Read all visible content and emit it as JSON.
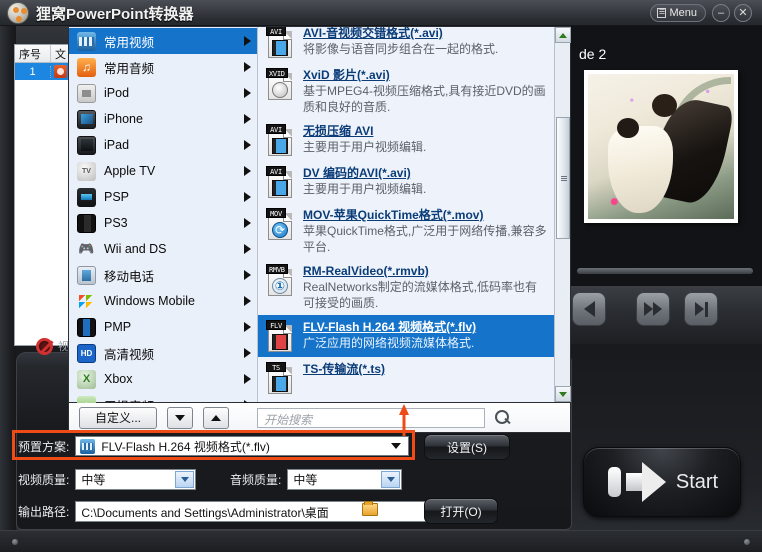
{
  "window": {
    "title": "狸窝PowerPoint转换器",
    "menu_label": "Menu",
    "minimize_label": "–",
    "close_label": "✕"
  },
  "filelist": {
    "columns": [
      "序号",
      "文"
    ],
    "rows": [
      {
        "num": "1"
      }
    ],
    "footer_text": "视"
  },
  "categories": [
    {
      "label": "常用视频",
      "icon": "video-icon",
      "selected": true
    },
    {
      "label": "常用音频",
      "icon": "audio-icon",
      "selected": false
    },
    {
      "label": "iPod",
      "icon": "ipod-icon",
      "selected": false
    },
    {
      "label": "iPhone",
      "icon": "iphone-icon",
      "selected": false
    },
    {
      "label": "iPad",
      "icon": "ipad-icon",
      "selected": false
    },
    {
      "label": "Apple TV",
      "icon": "apple-tv-icon",
      "selected": false
    },
    {
      "label": "PSP",
      "icon": "psp-icon",
      "selected": false
    },
    {
      "label": "PS3",
      "icon": "ps3-icon",
      "selected": false
    },
    {
      "label": "Wii and DS",
      "icon": "wii-icon",
      "selected": false
    },
    {
      "label": "移动电话",
      "icon": "mobile-phone-icon",
      "selected": false
    },
    {
      "label": "Windows Mobile",
      "icon": "windows-mobile-icon",
      "selected": false
    },
    {
      "label": "PMP",
      "icon": "pmp-icon",
      "selected": false
    },
    {
      "label": "高清视频",
      "icon": "hd-video-icon",
      "selected": false
    },
    {
      "label": "Xbox",
      "icon": "xbox-icon",
      "selected": false
    },
    {
      "label": "无损音频",
      "icon": "lossless-audio-icon",
      "selected": false
    }
  ],
  "formats": [
    {
      "tag": "AVI",
      "title": "AVI-音视频交错格式(*.avi)",
      "desc": "将影像与语音同步组合在一起的格式.",
      "selected": false
    },
    {
      "tag": "XVID",
      "title": "XviD 影片(*.avi)",
      "desc": "基于MPEG4-视频压缩格式,具有接近DVD的画质和良好的音质.",
      "selected": false
    },
    {
      "tag": "AVI",
      "title": "无损压缩 AVI",
      "desc": "主要用于用户视频编辑.",
      "selected": false
    },
    {
      "tag": "AVI",
      "title": "DV 编码的AVI(*.avi)",
      "desc": "主要用于用户视频编辑.",
      "selected": false
    },
    {
      "tag": "MOV",
      "title": "MOV-苹果QuickTime格式(*.mov)",
      "desc": "苹果QuickTime格式,广泛用于网络传播,兼容多平台.",
      "selected": false
    },
    {
      "tag": "RMVB",
      "title": "RM-RealVideo(*.rmvb)",
      "desc": "RealNetworks制定的流媒体格式,低码率也有可接受的画质.",
      "selected": false
    },
    {
      "tag": "FLV",
      "title": "FLV-Flash H.264 视频格式(*.flv)",
      "desc": "广泛应用的网络视频流媒体格式.",
      "selected": true
    },
    {
      "tag": "TS",
      "title": "TS-传输流(*.ts)",
      "desc": "",
      "selected": false
    }
  ],
  "toolstrip": {
    "custom_label": "自定义...",
    "spin_down_label": "▼",
    "spin_up_label": "▲",
    "search_placeholder": "开始搜索"
  },
  "settings": {
    "preset_label": "预置方案:",
    "preset_value": "FLV-Flash H.264 视频格式(*.flv)",
    "settings_button": "设置(S)",
    "video_quality_label": "视频质量:",
    "video_quality_value": "中等",
    "audio_quality_label": "音频质量:",
    "audio_quality_value": "中等",
    "output_path_label": "输出路径:",
    "output_path_value": "C:\\Documents and Settings\\Administrator\\桌面",
    "open_button": "打开(O)"
  },
  "preview": {
    "slide_label": "de 2"
  },
  "start": {
    "label": "Start"
  },
  "colors": {
    "accent_blue": "#1573c9",
    "highlight_red": "#ee4b16",
    "window_dark": "#1b1d21"
  }
}
